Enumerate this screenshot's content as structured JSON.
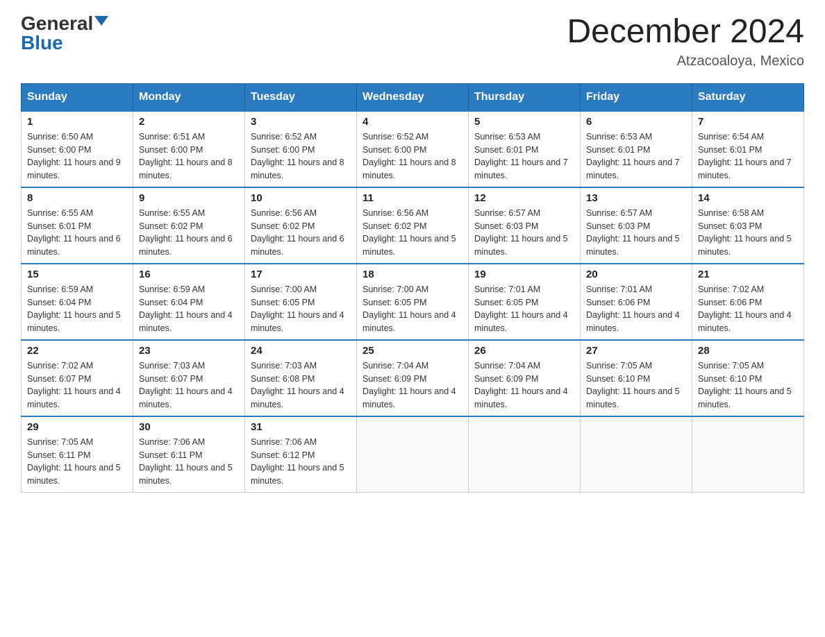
{
  "header": {
    "logo_general": "General",
    "logo_blue": "Blue",
    "month_title": "December 2024",
    "location": "Atzacoaloya, Mexico"
  },
  "weekdays": [
    "Sunday",
    "Monday",
    "Tuesday",
    "Wednesday",
    "Thursday",
    "Friday",
    "Saturday"
  ],
  "weeks": [
    [
      {
        "day": "1",
        "sunrise": "6:50 AM",
        "sunset": "6:00 PM",
        "daylight": "11 hours and 9 minutes."
      },
      {
        "day": "2",
        "sunrise": "6:51 AM",
        "sunset": "6:00 PM",
        "daylight": "11 hours and 8 minutes."
      },
      {
        "day": "3",
        "sunrise": "6:52 AM",
        "sunset": "6:00 PM",
        "daylight": "11 hours and 8 minutes."
      },
      {
        "day": "4",
        "sunrise": "6:52 AM",
        "sunset": "6:00 PM",
        "daylight": "11 hours and 8 minutes."
      },
      {
        "day": "5",
        "sunrise": "6:53 AM",
        "sunset": "6:01 PM",
        "daylight": "11 hours and 7 minutes."
      },
      {
        "day": "6",
        "sunrise": "6:53 AM",
        "sunset": "6:01 PM",
        "daylight": "11 hours and 7 minutes."
      },
      {
        "day": "7",
        "sunrise": "6:54 AM",
        "sunset": "6:01 PM",
        "daylight": "11 hours and 7 minutes."
      }
    ],
    [
      {
        "day": "8",
        "sunrise": "6:55 AM",
        "sunset": "6:01 PM",
        "daylight": "11 hours and 6 minutes."
      },
      {
        "day": "9",
        "sunrise": "6:55 AM",
        "sunset": "6:02 PM",
        "daylight": "11 hours and 6 minutes."
      },
      {
        "day": "10",
        "sunrise": "6:56 AM",
        "sunset": "6:02 PM",
        "daylight": "11 hours and 6 minutes."
      },
      {
        "day": "11",
        "sunrise": "6:56 AM",
        "sunset": "6:02 PM",
        "daylight": "11 hours and 5 minutes."
      },
      {
        "day": "12",
        "sunrise": "6:57 AM",
        "sunset": "6:03 PM",
        "daylight": "11 hours and 5 minutes."
      },
      {
        "day": "13",
        "sunrise": "6:57 AM",
        "sunset": "6:03 PM",
        "daylight": "11 hours and 5 minutes."
      },
      {
        "day": "14",
        "sunrise": "6:58 AM",
        "sunset": "6:03 PM",
        "daylight": "11 hours and 5 minutes."
      }
    ],
    [
      {
        "day": "15",
        "sunrise": "6:59 AM",
        "sunset": "6:04 PM",
        "daylight": "11 hours and 5 minutes."
      },
      {
        "day": "16",
        "sunrise": "6:59 AM",
        "sunset": "6:04 PM",
        "daylight": "11 hours and 4 minutes."
      },
      {
        "day": "17",
        "sunrise": "7:00 AM",
        "sunset": "6:05 PM",
        "daylight": "11 hours and 4 minutes."
      },
      {
        "day": "18",
        "sunrise": "7:00 AM",
        "sunset": "6:05 PM",
        "daylight": "11 hours and 4 minutes."
      },
      {
        "day": "19",
        "sunrise": "7:01 AM",
        "sunset": "6:05 PM",
        "daylight": "11 hours and 4 minutes."
      },
      {
        "day": "20",
        "sunrise": "7:01 AM",
        "sunset": "6:06 PM",
        "daylight": "11 hours and 4 minutes."
      },
      {
        "day": "21",
        "sunrise": "7:02 AM",
        "sunset": "6:06 PM",
        "daylight": "11 hours and 4 minutes."
      }
    ],
    [
      {
        "day": "22",
        "sunrise": "7:02 AM",
        "sunset": "6:07 PM",
        "daylight": "11 hours and 4 minutes."
      },
      {
        "day": "23",
        "sunrise": "7:03 AM",
        "sunset": "6:07 PM",
        "daylight": "11 hours and 4 minutes."
      },
      {
        "day": "24",
        "sunrise": "7:03 AM",
        "sunset": "6:08 PM",
        "daylight": "11 hours and 4 minutes."
      },
      {
        "day": "25",
        "sunrise": "7:04 AM",
        "sunset": "6:09 PM",
        "daylight": "11 hours and 4 minutes."
      },
      {
        "day": "26",
        "sunrise": "7:04 AM",
        "sunset": "6:09 PM",
        "daylight": "11 hours and 4 minutes."
      },
      {
        "day": "27",
        "sunrise": "7:05 AM",
        "sunset": "6:10 PM",
        "daylight": "11 hours and 5 minutes."
      },
      {
        "day": "28",
        "sunrise": "7:05 AM",
        "sunset": "6:10 PM",
        "daylight": "11 hours and 5 minutes."
      }
    ],
    [
      {
        "day": "29",
        "sunrise": "7:05 AM",
        "sunset": "6:11 PM",
        "daylight": "11 hours and 5 minutes."
      },
      {
        "day": "30",
        "sunrise": "7:06 AM",
        "sunset": "6:11 PM",
        "daylight": "11 hours and 5 minutes."
      },
      {
        "day": "31",
        "sunrise": "7:06 AM",
        "sunset": "6:12 PM",
        "daylight": "11 hours and 5 minutes."
      },
      null,
      null,
      null,
      null
    ]
  ]
}
